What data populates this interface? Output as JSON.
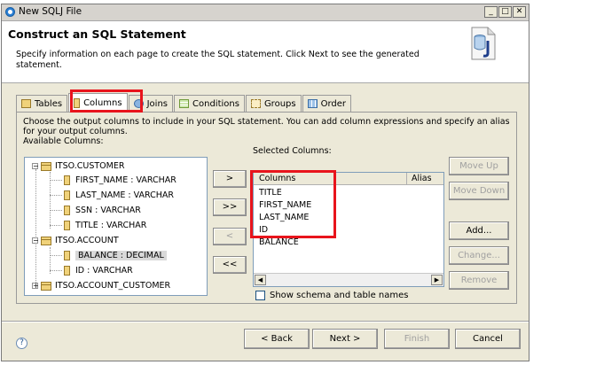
{
  "window": {
    "title": "New SQLJ File",
    "minimize": "_",
    "maximize": "□",
    "close": "✕"
  },
  "header": {
    "title": "Construct an SQL Statement",
    "description": "Specify information on each page to create the SQL statement. Click Next to see the generated statement."
  },
  "tabs": [
    {
      "label": "Tables",
      "icon": "table-icon"
    },
    {
      "label": "Columns",
      "icon": "column-icon"
    },
    {
      "label": "Joins",
      "icon": "joins-icon"
    },
    {
      "label": "Conditions",
      "icon": "conditions-icon"
    },
    {
      "label": "Groups",
      "icon": "groups-icon"
    },
    {
      "label": "Order",
      "icon": "order-icon"
    }
  ],
  "columns_page": {
    "instructions": "Choose the output columns to include in your SQL statement. You can add column expressions and specify an alias for your output columns.",
    "available_label": "Available Columns:",
    "selected_label": "Selected Columns:",
    "tree": {
      "customer": {
        "name": "ITSO.CUSTOMER",
        "expander": "−"
      },
      "customer_cols": [
        "FIRST_NAME : VARCHAR",
        "LAST_NAME : VARCHAR",
        "SSN : VARCHAR",
        "TITLE : VARCHAR"
      ],
      "account": {
        "name": "ITSO.ACCOUNT",
        "expander": "−"
      },
      "account_cols": [
        "BALANCE : DECIMAL",
        "ID : VARCHAR"
      ],
      "account_customer": {
        "name": "ITSO.ACCOUNT_CUSTOMER",
        "expander": "+"
      }
    },
    "move_buttons": {
      "add_one": ">",
      "add_all": ">>",
      "remove_one": "<",
      "remove_all": "<<"
    },
    "selected_header": {
      "columns": "Columns",
      "alias": "Alias"
    },
    "selected": [
      "TITLE",
      "FIRST_NAME",
      "LAST_NAME",
      "ID",
      "BALANCE"
    ],
    "scroll_left": "◀",
    "scroll_right": "▶",
    "side_buttons": {
      "move_up": "Move Up",
      "move_down": "Move Down",
      "add": "Add...",
      "change": "Change...",
      "remove": "Remove"
    },
    "show_schema": "Show schema and table names"
  },
  "footer": {
    "help": "?",
    "back": "< Back",
    "next": "Next >",
    "finish": "Finish",
    "cancel": "Cancel"
  },
  "colors": {
    "highlight": "#e8141c",
    "selection_bg": "#d9d9d9"
  }
}
